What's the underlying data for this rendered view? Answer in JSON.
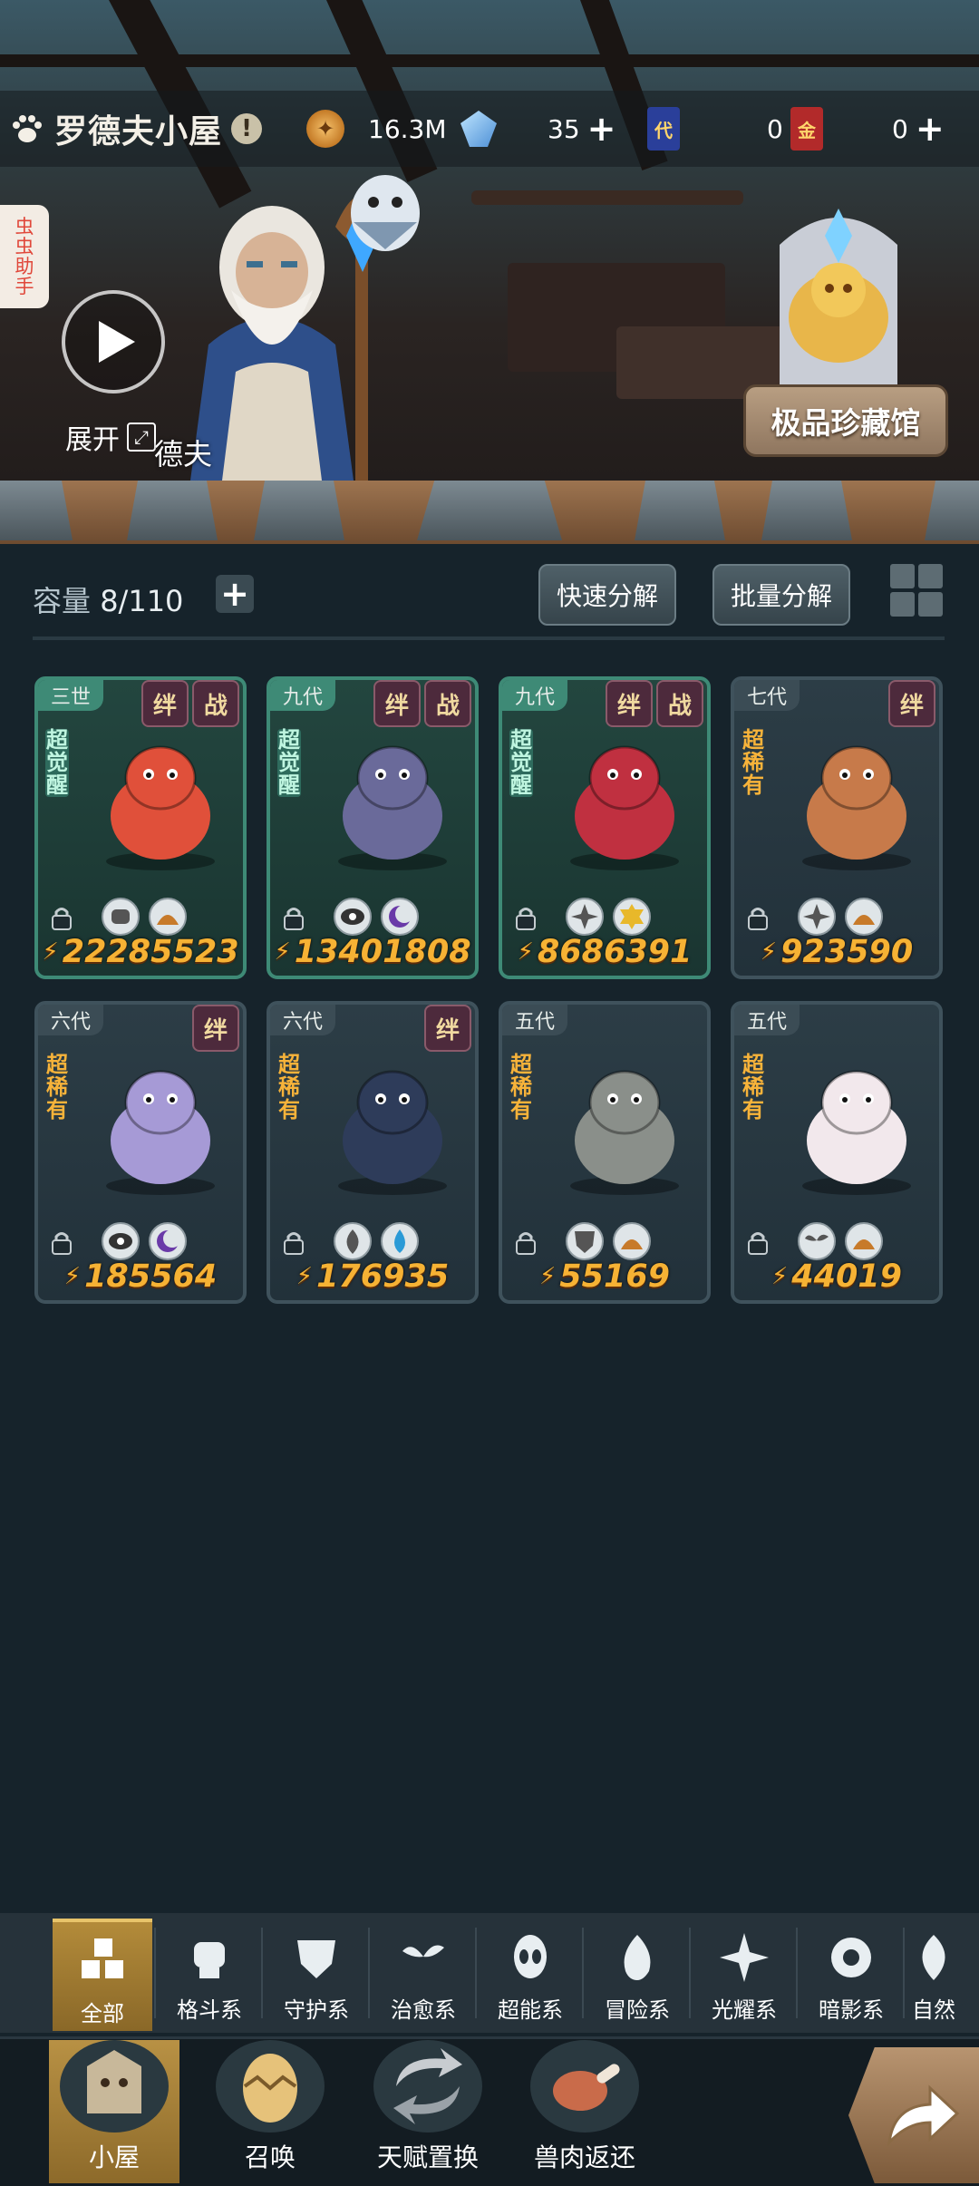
{
  "header": {
    "title": "罗德夫小屋",
    "alert": "!",
    "resources": {
      "coins": "16.3M",
      "crystals": "35",
      "card_a_label": "代",
      "card_a": "0",
      "card_b_label": "金",
      "card_b": "0"
    }
  },
  "side_tab": [
    "虫",
    "虫",
    "助",
    "手"
  ],
  "npc": {
    "expand_label": "展开",
    "name": "德夫"
  },
  "museum_label": "极品珍藏馆",
  "storage": {
    "label": "容量",
    "value": "8/110",
    "quick_decompose": "快速分解",
    "batch_decompose": "批量分解"
  },
  "cards": [
    {
      "gen": "三世",
      "tags": [
        "绊",
        "战"
      ],
      "rarity": [
        "超",
        "觉",
        "醒"
      ],
      "power": "22285523",
      "elements": [
        "fist",
        "beast"
      ],
      "theme": "teal",
      "color": "#e0503a"
    },
    {
      "gen": "九代",
      "tags": [
        "绊",
        "战"
      ],
      "rarity": [
        "超",
        "觉",
        "醒"
      ],
      "power": "13401808",
      "elements": [
        "eye",
        "moon"
      ],
      "theme": "teal",
      "color": "#6a6a9a"
    },
    {
      "gen": "九代",
      "tags": [
        "绊",
        "战"
      ],
      "rarity": [
        "超",
        "觉",
        "醒"
      ],
      "power": "8686391",
      "elements": [
        "star",
        "hexstar"
      ],
      "theme": "teal",
      "color": "#c03040"
    },
    {
      "gen": "七代",
      "tags": [
        "绊"
      ],
      "rarity": [
        "超",
        "稀",
        "有"
      ],
      "power": "923590",
      "elements": [
        "star",
        "beast"
      ],
      "theme": "gray",
      "color": "#c77a4a"
    },
    {
      "gen": "六代",
      "tags": [
        "绊"
      ],
      "rarity": [
        "超",
        "稀",
        "有"
      ],
      "power": "185564",
      "elements": [
        "eye",
        "moon"
      ],
      "theme": "gray",
      "color": "#a69ad6"
    },
    {
      "gen": "六代",
      "tags": [
        "绊"
      ],
      "rarity": [
        "超",
        "稀",
        "有"
      ],
      "power": "176935",
      "elements": [
        "leaf",
        "drop"
      ],
      "theme": "gray",
      "color": "#2e3c5a"
    },
    {
      "gen": "五代",
      "tags": [],
      "rarity": [
        "超",
        "稀",
        "有"
      ],
      "power": "55169",
      "elements": [
        "shield",
        "beast"
      ],
      "theme": "gray",
      "color": "#8a8f8a"
    },
    {
      "gen": "五代",
      "tags": [],
      "rarity": [
        "超",
        "稀",
        "有"
      ],
      "power": "44019",
      "elements": [
        "sprout",
        "beast"
      ],
      "theme": "gray",
      "color": "#f2e8ec"
    }
  ],
  "categories": [
    {
      "label": "全部",
      "icon": "all-icon"
    },
    {
      "label": "格斗系",
      "icon": "fist-icon"
    },
    {
      "label": "守护系",
      "icon": "shield-icon"
    },
    {
      "label": "治愈系",
      "icon": "sprout-icon"
    },
    {
      "label": "超能系",
      "icon": "alien-icon"
    },
    {
      "label": "冒险系",
      "icon": "flame-icon"
    },
    {
      "label": "光耀系",
      "icon": "star-icon"
    },
    {
      "label": "暗影系",
      "icon": "eye-icon"
    },
    {
      "label": "自然",
      "icon": "leaf-icon"
    }
  ],
  "nav": [
    {
      "label": "小屋",
      "icon": "house-icon"
    },
    {
      "label": "召唤",
      "icon": "egg-icon"
    },
    {
      "label": "天赋置换",
      "icon": "swap-icon"
    },
    {
      "label": "兽肉返还",
      "icon": "meat-icon"
    }
  ],
  "colors": {
    "accent": "#f6b234",
    "teal": "#3e8a76",
    "active_tab": "#b38b3a"
  }
}
